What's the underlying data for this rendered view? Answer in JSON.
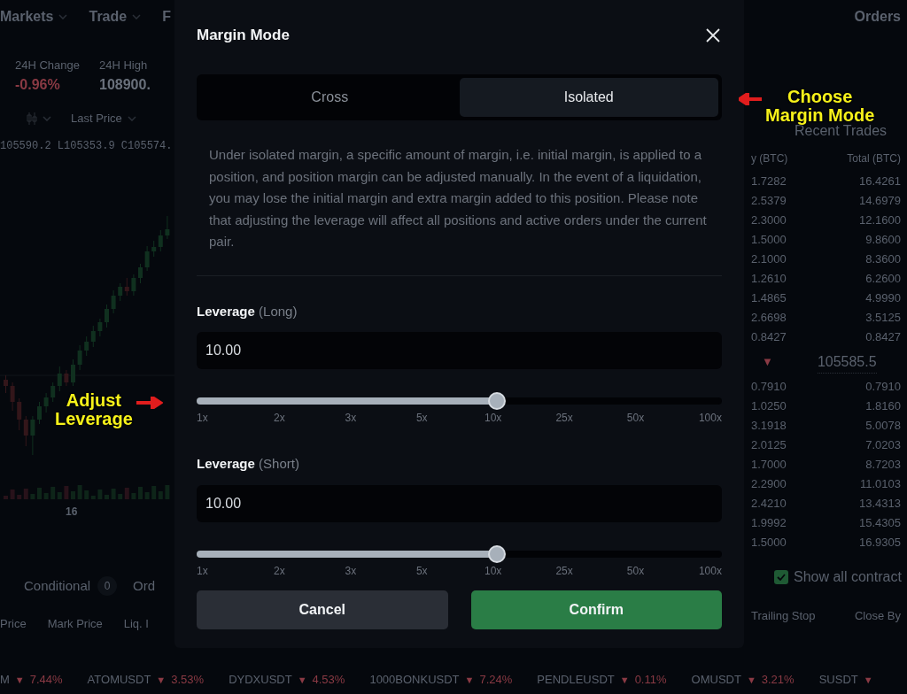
{
  "background": {
    "top_nav": [
      {
        "label": "Markets"
      },
      {
        "label": "Trade"
      },
      {
        "label": "F"
      }
    ],
    "nav_right": "Orders",
    "stats": [
      {
        "label": "24H Change",
        "value": "-0.96%",
        "kind": "down"
      },
      {
        "label": "24H High",
        "value": "108900.",
        "kind": "neutral"
      }
    ],
    "price_type": "Last Price",
    "ohlc": "105590.2 L105353.9 C105574.",
    "chart_axis_label": "16",
    "order_tabs": [
      {
        "label": "Conditional",
        "count": "0"
      },
      {
        "label": "Ord"
      }
    ],
    "positions_columns": [
      "Price",
      "Mark Price",
      "Liq. I"
    ],
    "recent_trades": {
      "title": "Recent Trades",
      "columns": [
        "y (BTC)",
        "Total (BTC)"
      ],
      "asks": [
        [
          "1.7282",
          "16.4261"
        ],
        [
          "2.5379",
          "14.6979"
        ],
        [
          "2.3000",
          "12.1600"
        ],
        [
          "1.5000",
          "9.8600"
        ],
        [
          "2.1000",
          "8.3600"
        ],
        [
          "1.2610",
          "6.2600"
        ],
        [
          "1.4865",
          "4.9990"
        ],
        [
          "2.6698",
          "3.5125"
        ],
        [
          "0.8427",
          "0.8427"
        ]
      ],
      "last_price": {
        "arrow": "▼",
        "value": "105585.5"
      },
      "bids": [
        [
          "0.7910",
          "0.7910"
        ],
        [
          "1.0250",
          "1.8160"
        ],
        [
          "3.1918",
          "5.0078"
        ],
        [
          "2.0125",
          "7.0203"
        ],
        [
          "1.7000",
          "8.7203"
        ],
        [
          "2.2900",
          "11.0103"
        ],
        [
          "2.4210",
          "13.4313"
        ],
        [
          "1.9992",
          "15.4305"
        ],
        [
          "1.5000",
          "16.9305"
        ]
      ]
    },
    "show_all": {
      "label": "Show all contract",
      "checked": true
    },
    "right_columns": [
      "Trailing Stop",
      "Close By"
    ],
    "ticker": [
      {
        "symbol": "M",
        "arrow": "▼",
        "change": "7.44%"
      },
      {
        "symbol": "ATOMUSDT",
        "arrow": "▼",
        "change": "3.53%"
      },
      {
        "symbol": "DYDXUSDT",
        "arrow": "▼",
        "change": "4.53%"
      },
      {
        "symbol": "1000BONKUSDT",
        "arrow": "▼",
        "change": "7.24%"
      },
      {
        "symbol": "PENDLEUSDT",
        "arrow": "▼",
        "change": "0.11%"
      },
      {
        "symbol": "OMUSDT",
        "arrow": "▼",
        "change": "3.21%"
      },
      {
        "symbol": "SUSDT",
        "arrow": "▼"
      }
    ]
  },
  "dialog": {
    "title": "Margin Mode",
    "tabs": [
      {
        "label": "Cross",
        "selected": false
      },
      {
        "label": "Isolated",
        "selected": true
      }
    ],
    "description": "Under isolated margin, a specific amount of margin, i.e. initial margin, is applied to a position, and position margin can be adjusted manually. In the event of a liquidation, you may lose the initial margin and extra margin added to this position. Please note that adjusting the leverage will affect all positions and active orders under the current pair.",
    "leverage": [
      {
        "label": "**Leverage** (Long)",
        "value": "10.00",
        "level": 0.5714,
        "ticks": [
          "1x",
          "2x",
          "3x",
          "5x",
          "10x",
          "25x",
          "50x",
          "100x"
        ]
      },
      {
        "label": "**Leverage** (Short)",
        "value": "10.00",
        "level": 0.5714,
        "ticks": [
          "1x",
          "2x",
          "3x",
          "5x",
          "10x",
          "25x",
          "50x",
          "100x"
        ]
      }
    ],
    "buttons": [
      {
        "label": "Cancel",
        "kind": "secondary"
      },
      {
        "label": "Confirm",
        "kind": "primary"
      }
    ]
  },
  "annotations": [
    {
      "lines": [
        "Choose",
        "Margin Mode"
      ],
      "kind": "arrow-left"
    },
    {
      "lines": [
        "Adjust",
        "Leverage"
      ],
      "kind": "arrow-right"
    }
  ]
}
